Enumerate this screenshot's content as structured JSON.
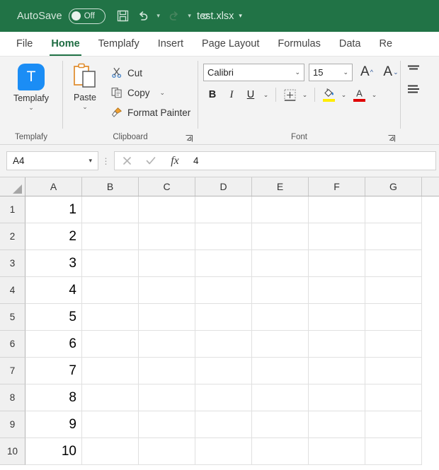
{
  "titlebar": {
    "autosave_label": "AutoSave",
    "autosave_state": "Off",
    "save_icon": "save-floppy-icon",
    "undo_icon": "undo-icon",
    "redo_icon": "redo-icon",
    "customize_icon": "customize-quick-access-toolbar-icon",
    "document_title": "test.xlsx",
    "background_color": "#217346"
  },
  "tabs": [
    {
      "label": "File",
      "active": false
    },
    {
      "label": "Home",
      "active": true
    },
    {
      "label": "Templafy",
      "active": false
    },
    {
      "label": "Insert",
      "active": false
    },
    {
      "label": "Page Layout",
      "active": false
    },
    {
      "label": "Formulas",
      "active": false
    },
    {
      "label": "Data",
      "active": false
    },
    {
      "label": "Re",
      "active": false
    }
  ],
  "ribbon": {
    "templafy_group": {
      "group_label": "Templafy",
      "button_label": "Templafy",
      "icon_letter": "T",
      "icon_color": "#1b8df5"
    },
    "clipboard_group": {
      "group_label": "Clipboard",
      "paste_label": "Paste",
      "cut_label": "Cut",
      "copy_label": "Copy",
      "format_painter_label": "Format Painter"
    },
    "font_group": {
      "group_label": "Font",
      "font_name": "Calibri",
      "font_size": "15",
      "grow_font_label": "A",
      "shrink_font_label": "A",
      "bold_label": "B",
      "italic_label": "I",
      "underline_label": "U",
      "fill_color": "#ffec00",
      "font_color": "#e00000"
    }
  },
  "formulabar": {
    "name_box_value": "A4",
    "cancel_icon": "cancel-x-icon",
    "confirm_icon": "confirm-check-icon",
    "function_icon": "fx",
    "formula_value": "4"
  },
  "grid": {
    "columns": [
      "A",
      "B",
      "C",
      "D",
      "E",
      "F",
      "G"
    ],
    "rows": [
      {
        "number": "1",
        "cells": [
          "1",
          "",
          "",
          "",
          "",
          "",
          ""
        ]
      },
      {
        "number": "2",
        "cells": [
          "2",
          "",
          "",
          "",
          "",
          "",
          ""
        ]
      },
      {
        "number": "3",
        "cells": [
          "3",
          "",
          "",
          "",
          "",
          "",
          ""
        ]
      },
      {
        "number": "4",
        "cells": [
          "4",
          "",
          "",
          "",
          "",
          "",
          ""
        ]
      },
      {
        "number": "5",
        "cells": [
          "5",
          "",
          "",
          "",
          "",
          "",
          ""
        ]
      },
      {
        "number": "6",
        "cells": [
          "6",
          "",
          "",
          "",
          "",
          "",
          ""
        ]
      },
      {
        "number": "7",
        "cells": [
          "7",
          "",
          "",
          "",
          "",
          "",
          ""
        ]
      },
      {
        "number": "8",
        "cells": [
          "8",
          "",
          "",
          "",
          "",
          "",
          ""
        ]
      },
      {
        "number": "9",
        "cells": [
          "9",
          "",
          "",
          "",
          "",
          "",
          ""
        ]
      },
      {
        "number": "10",
        "cells": [
          "10",
          "",
          "",
          "",
          "",
          "",
          ""
        ]
      }
    ],
    "selected_cell": "A4"
  }
}
